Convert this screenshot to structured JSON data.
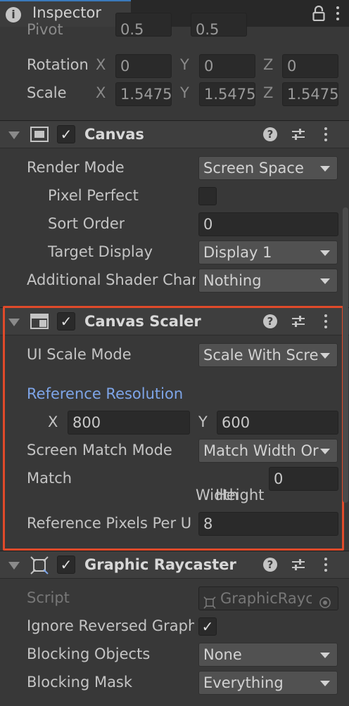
{
  "tab": {
    "title": "Inspector",
    "info_icon": "i"
  },
  "transform": {
    "pivot_label": "Pivot",
    "pivot_x": "0.5",
    "pivot_y": "0.5",
    "rotation_label": "Rotation",
    "rotation": {
      "x": "0",
      "y": "0",
      "z": "0"
    },
    "scale_label": "Scale",
    "scale": {
      "x": "1.5475",
      "y": "1.5475",
      "z": "1.5475"
    },
    "axis_x": "X",
    "axis_y": "Y",
    "axis_z": "Z"
  },
  "canvas": {
    "title": "Canvas",
    "render_mode_label": "Render Mode",
    "render_mode_value": "Screen Space",
    "pixel_perfect_label": "Pixel Perfect",
    "sort_order_label": "Sort Order",
    "sort_order_value": "0",
    "target_display_label": "Target Display",
    "target_display_value": "Display 1",
    "shader_channels_label": "Additional Shader Channels",
    "shader_channels_value": "Nothing"
  },
  "canvas_scaler": {
    "title": "Canvas Scaler",
    "ui_scale_mode_label": "UI Scale Mode",
    "ui_scale_mode_value": "Scale With Screen Size",
    "reference_resolution_label": "Reference Resolution",
    "ref_x_label": "X",
    "ref_x_value": "800",
    "ref_y_label": "Y",
    "ref_y_value": "600",
    "screen_match_mode_label": "Screen Match Mode",
    "screen_match_mode_value": "Match Width Or Height",
    "match_label": "Match",
    "match_value": "0",
    "match_width_label": "Width",
    "match_height_label": "Height",
    "ref_pixels_label": "Reference Pixels Per Unit",
    "ref_pixels_value": "8"
  },
  "graphic_raycaster": {
    "title": "Graphic Raycaster",
    "script_label": "Script",
    "script_value": "GraphicRaycaster",
    "ignore_reversed_label": "Ignore Reversed Graphics",
    "ignore_reversed_checked": "✓",
    "blocking_objects_label": "Blocking Objects",
    "blocking_objects_value": "None",
    "blocking_mask_label": "Blocking Mask",
    "blocking_mask_value": "Everything"
  },
  "checkmark": "✓",
  "help_glyph": "?",
  "colors": {
    "highlight": "#e04a2a",
    "link_blue": "#7ea5e8",
    "tab_accent": "#3a79bb"
  }
}
